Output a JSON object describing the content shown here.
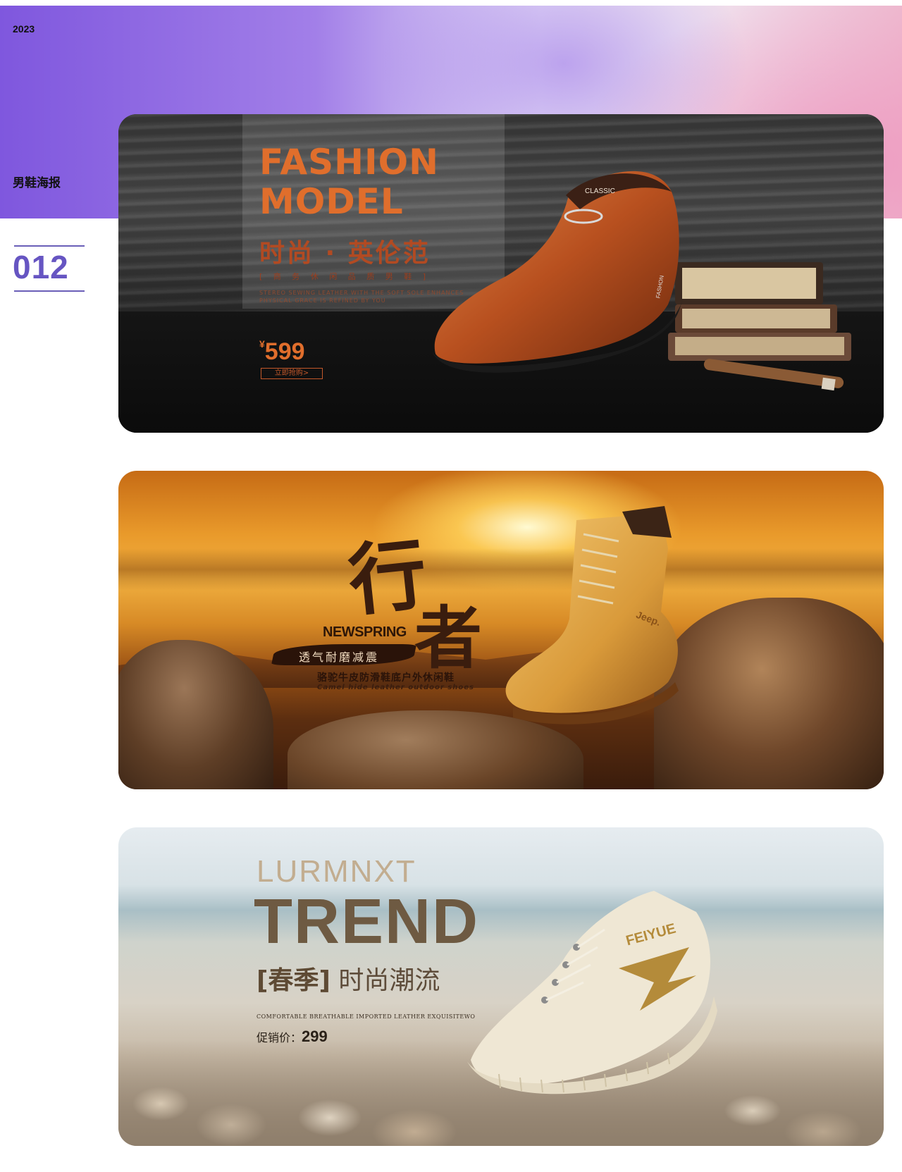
{
  "header": {
    "year": "2023",
    "category_title": "男鞋海报",
    "number": "012"
  },
  "banners": [
    {
      "headline": "FASHION MODEL",
      "headline_line1": "FASHION",
      "headline_line2": "MODEL",
      "chinese_title": "时尚 · 英伦范",
      "subtitle": "[ 商 务 休 闲 品 质 男 鞋 ]",
      "english_copy_line1": "STEREO SEWING LEATHER WITH THE SOFT SOLE ENHANCES",
      "english_copy_line2": "PHYSICAL GRACE IS REFINED BY YOU",
      "currency": "¥",
      "price": "599",
      "buy_label": "立即抢购>",
      "shoe_tongue_text": "CLASSIC",
      "shoe_heel_text": "FASHON",
      "icon": "leather-loafer-icon"
    },
    {
      "big_char_1": "行",
      "big_char_2": "者",
      "tagline_en": "NEWSPRING",
      "brush_label": "透气耐磨减震",
      "product_cn": "骆驼牛皮防滑鞋底户外休闲鞋",
      "product_en": "Camel hide leather outdoor shoes",
      "shoe_brand": "Jeep.",
      "icon": "work-boot-icon"
    },
    {
      "brand": "LURMNXT",
      "headline": "TREND",
      "season_tag": "[春季]",
      "chinese_title": "时尚潮流",
      "english_copy": "COMFORTABLE BREATHABLE IMPORTED LEATHER EXQUISITEWO",
      "price_label": "促销价：",
      "price": "299",
      "shoe_brand": "FEIYUE",
      "icon": "canvas-sneaker-icon"
    }
  ],
  "colors": {
    "accent_purple": "#6655c2",
    "fashion_orange": "#e06e2c",
    "trend_brown": "#6e5a42"
  }
}
